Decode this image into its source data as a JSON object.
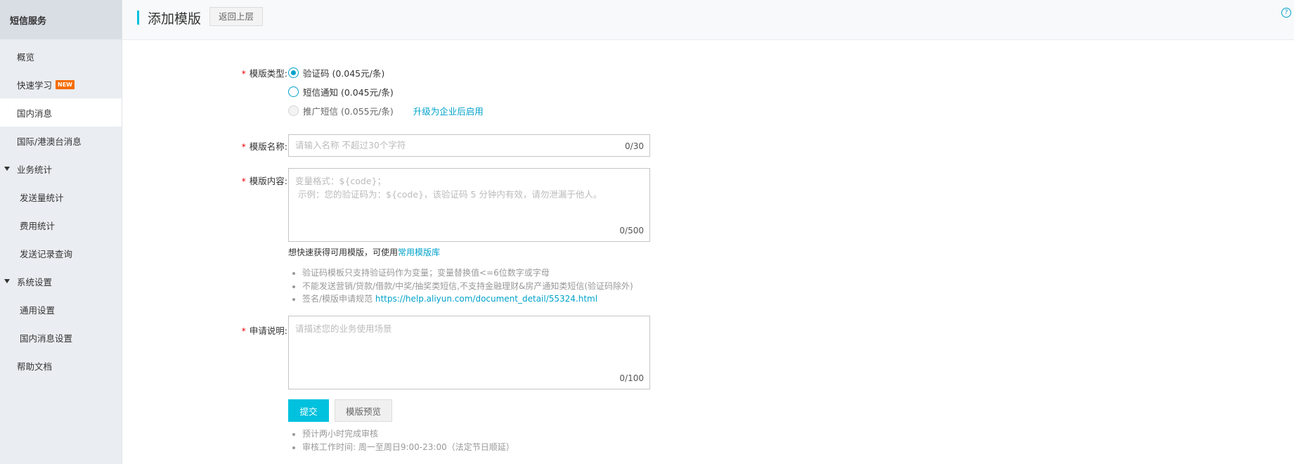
{
  "sidebar": {
    "title": "短信服务",
    "items": [
      {
        "label": "概览"
      },
      {
        "label": "快速学习",
        "badge": "NEW"
      },
      {
        "label": "国内消息"
      },
      {
        "label": "国际/港澳台消息"
      },
      {
        "label": "业务统计"
      },
      {
        "label": "发送量统计"
      },
      {
        "label": "费用统计"
      },
      {
        "label": "发送记录查询"
      },
      {
        "label": "系统设置"
      },
      {
        "label": "通用设置"
      },
      {
        "label": "国内消息设置"
      },
      {
        "label": "帮助文档"
      }
    ]
  },
  "header": {
    "title": "添加模版",
    "back_label": "返回上层",
    "help_icon": "?"
  },
  "form": {
    "required_mark": "*",
    "type": {
      "label": "模版类型:",
      "options": [
        {
          "label": "验证码 (0.045元/条)",
          "selected": true
        },
        {
          "label": "短信通知 (0.045元/条)",
          "selected": false
        },
        {
          "label": "推广短信 (0.055元/条)",
          "selected": false,
          "disabled": true
        }
      ],
      "upgrade_link": "升级为企业后启用"
    },
    "name": {
      "label": "模版名称:",
      "placeholder": "请输入名称 不超过30个字符",
      "counter": "0/30"
    },
    "content": {
      "label": "模版内容:",
      "placeholder": "变量格式：${code}；\n 示例：您的验证码为：${code}，该验证码 5 分钟内有效，请勿泄漏于他人。",
      "counter": "0/500",
      "hint_prefix": "想快速获得可用模版，可使用",
      "hint_link": "常用模版库",
      "rules": [
        "验证码模板只支持验证码作为变量；变量替换值<=6位数字或字母",
        "不能发送营销/贷款/借款/中奖/抽奖类短信,不支持金融理财&房产通知类短信(验证码除外)"
      ],
      "rule_link_prefix": "签名/模版申请规范 ",
      "rule_link": "https://help.aliyun.com/document_detail/55324.html"
    },
    "description": {
      "label": "申请说明:",
      "placeholder": "请描述您的业务使用场景",
      "counter": "0/100"
    },
    "submit_label": "提交",
    "preview_label": "模版预览",
    "notes": [
      "预计两小时完成审核",
      "审核工作时间: 周一至周日9:00-23:00（法定节日顺延）"
    ]
  },
  "colors": {
    "accent": "#00c1de",
    "link": "#00a2ca",
    "required": "#e00000",
    "badge": "#f56c00",
    "sidebar_bg": "#eaedf1"
  }
}
